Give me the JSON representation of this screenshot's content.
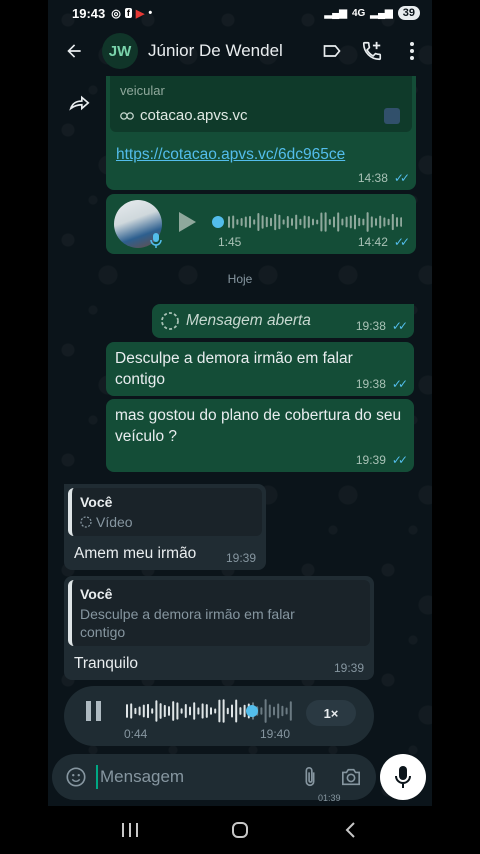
{
  "status": {
    "time": "19:43",
    "battery": "39",
    "network": "4G"
  },
  "header": {
    "avatar_initials": "JW",
    "contact_name": "Júnior De Wendel"
  },
  "messages": {
    "link": {
      "preview_title": "veicular",
      "domain": "cotacao.apvs.vc",
      "url": "https://cotacao.apvs.vc/6dc965ce",
      "time": "14:38"
    },
    "voice1": {
      "duration": "1:45",
      "time": "14:42"
    },
    "date_divider": "Hoje",
    "view_once": {
      "text": "Mensagem aberta",
      "time": "19:38"
    },
    "out1": {
      "text": "Desculpe a demora irmão  em falar contigo",
      "time": "19:38"
    },
    "out2": {
      "text": "mas gostou do plano de cobertura do seu veículo ?",
      "time": "19:39"
    },
    "in1": {
      "quote_author": "Você",
      "quote_text": "Vídeo",
      "text": "Amem meu irmão",
      "time": "19:39"
    },
    "in2": {
      "quote_author": "Você",
      "quote_text": "Desculpe a demora irmão  em falar contigo",
      "text": "Tranquilo",
      "time": "19:39"
    }
  },
  "recorder": {
    "elapsed": "0:44",
    "time": "19:40",
    "speed": "1×"
  },
  "composer": {
    "placeholder": "Mensagem",
    "rec_time": "01:39"
  },
  "colors": {
    "outgoing_bubble": "#144d37",
    "incoming_bubble": "#202c33",
    "read_ticks": "#53bdeb",
    "background": "#0b141a"
  }
}
